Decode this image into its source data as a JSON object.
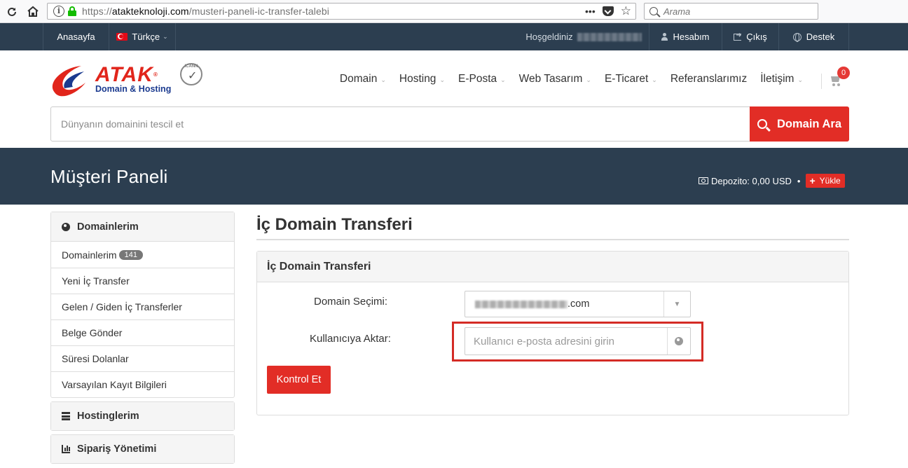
{
  "browser": {
    "url_prefix": "https://",
    "url_domain": "atakteknoloji.com",
    "url_path": "/musteri-paneli-ic-transfer-talebi",
    "menu_dots": "•••",
    "search_placeholder": "Arama"
  },
  "topbar": {
    "home": "Anasayfa",
    "language": "Türkçe",
    "welcome": "Hoşgeldiniz",
    "account": "Hesabım",
    "logout": "Çıkış",
    "support": "Destek"
  },
  "logo": {
    "name": "ATAK",
    "tagline": "Domain & Hosting",
    "registered": "®",
    "icann": "ICANN"
  },
  "mainnav": [
    {
      "label": "Domain",
      "dropdown": true
    },
    {
      "label": "Hosting",
      "dropdown": true
    },
    {
      "label": "E-Posta",
      "dropdown": true
    },
    {
      "label": "Web Tasarım",
      "dropdown": true
    },
    {
      "label": "E-Ticaret",
      "dropdown": true
    },
    {
      "label": "Referanslarımız",
      "dropdown": false
    },
    {
      "label": "İletişim",
      "dropdown": true
    }
  ],
  "cart": {
    "count": "0"
  },
  "domain_search": {
    "placeholder": "Dünyanın domainini tescil et",
    "button": "Domain Ara"
  },
  "banner": {
    "title": "Müşteri Paneli",
    "deposit": "Depozito: 0,00 USD",
    "dot": "•",
    "topup": "Yükle"
  },
  "sidebar": {
    "domains_title": "Domainlerim",
    "domain_items": [
      {
        "label": "Domainlerim",
        "count": "141"
      },
      {
        "label": "Yeni İç Transfer"
      },
      {
        "label": "Gelen / Giden İç Transferler"
      },
      {
        "label": "Belge Gönder"
      },
      {
        "label": "Süresi Dolanlar"
      },
      {
        "label": "Varsayılan Kayıt Bilgileri"
      }
    ],
    "hosting_title": "Hostinglerim",
    "orders_title": "Sipariş Yönetimi"
  },
  "main": {
    "page_title": "İç Domain Transferi",
    "card_title": "İç Domain Transferi",
    "domain_label": "Domain Seçimi:",
    "domain_suffix": ".com",
    "user_label": "Kullanıcıya Aktar:",
    "email_placeholder": "Kullanıcı e-posta adresini girin",
    "submit": "Kontrol Et"
  },
  "colors": {
    "dark_navy": "#2c3e50",
    "accent_red": "#e22d26",
    "highlight_red": "#d42b25"
  }
}
